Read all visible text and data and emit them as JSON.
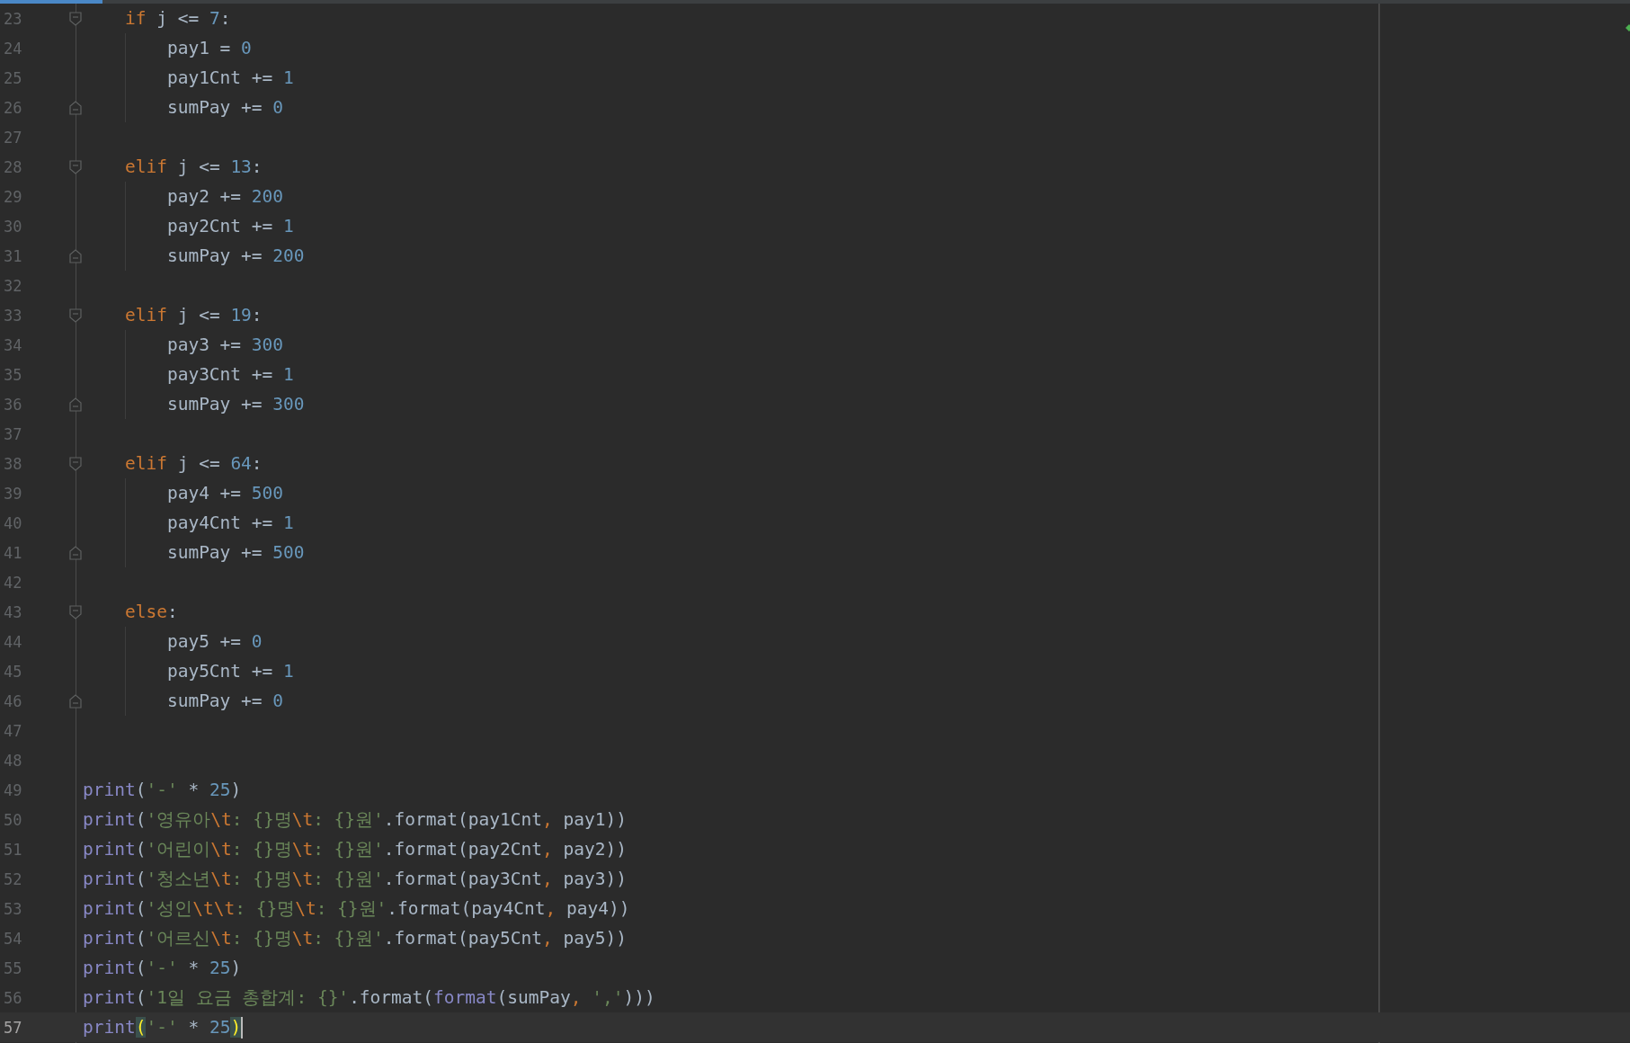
{
  "loop_body": [
    {
      "number": "23",
      "kind": "fold_start",
      "current": false,
      "tokens": [
        {
          "kind": "keyword",
          "text": "if"
        },
        {
          "kind": "plain",
          "text": " j <= "
        },
        {
          "kind": "number",
          "text": "7"
        },
        {
          "kind": "plain",
          "text": ":"
        }
      ],
      "children": [
        {
          "number": "24",
          "kind": "plain",
          "current": false,
          "tokens": [
            {
              "kind": "plain",
              "text": "pay1 = "
            },
            {
              "kind": "number",
              "text": "0"
            }
          ]
        },
        {
          "number": "25",
          "kind": "plain",
          "current": false,
          "tokens": [
            {
              "kind": "plain",
              "text": "pay1Cnt += "
            },
            {
              "kind": "number",
              "text": "1"
            }
          ]
        },
        {
          "number": "26",
          "kind": "fold_end",
          "current": false,
          "tokens": [
            {
              "kind": "plain",
              "text": "sumPay += "
            },
            {
              "kind": "number",
              "text": "0"
            }
          ]
        }
      ]
    },
    {
      "number": "27",
      "kind": "plain",
      "current": false
    },
    {
      "number": "28",
      "kind": "fold_start",
      "current": false,
      "tokens": [
        {
          "kind": "keyword",
          "text": "elif"
        },
        {
          "kind": "plain",
          "text": " j <= "
        },
        {
          "kind": "number",
          "text": "13"
        },
        {
          "kind": "plain",
          "text": ":"
        }
      ],
      "children": [
        {
          "number": "29",
          "kind": "plain",
          "current": false,
          "tokens": [
            {
              "kind": "plain",
              "text": "pay2 += "
            },
            {
              "kind": "number",
              "text": "200"
            }
          ]
        },
        {
          "number": "30",
          "kind": "plain",
          "current": false,
          "tokens": [
            {
              "kind": "plain",
              "text": "pay2Cnt += "
            },
            {
              "kind": "number",
              "text": "1"
            }
          ]
        },
        {
          "number": "31",
          "kind": "fold_end",
          "current": false,
          "tokens": [
            {
              "kind": "plain",
              "text": "sumPay += "
            },
            {
              "kind": "number",
              "text": "200"
            }
          ]
        }
      ]
    },
    {
      "number": "32",
      "kind": "plain",
      "current": false
    },
    {
      "number": "33",
      "kind": "fold_start",
      "current": false,
      "tokens": [
        {
          "kind": "keyword",
          "text": "elif"
        },
        {
          "kind": "plain",
          "text": " j <= "
        },
        {
          "kind": "number",
          "text": "19"
        },
        {
          "kind": "plain",
          "text": ":"
        }
      ],
      "children": [
        {
          "number": "34",
          "kind": "plain",
          "current": false,
          "tokens": [
            {
              "kind": "plain",
              "text": "pay3 += "
            },
            {
              "kind": "number",
              "text": "300"
            }
          ]
        },
        {
          "number": "35",
          "kind": "plain",
          "current": false,
          "tokens": [
            {
              "kind": "plain",
              "text": "pay3Cnt += "
            },
            {
              "kind": "number",
              "text": "1"
            }
          ]
        },
        {
          "number": "36",
          "kind": "fold_end",
          "current": false,
          "tokens": [
            {
              "kind": "plain",
              "text": "sumPay += "
            },
            {
              "kind": "number",
              "text": "300"
            }
          ]
        }
      ]
    },
    {
      "number": "37",
      "kind": "plain",
      "current": false
    },
    {
      "number": "38",
      "kind": "fold_start",
      "current": false,
      "tokens": [
        {
          "kind": "keyword",
          "text": "elif"
        },
        {
          "kind": "plain",
          "text": " j <= "
        },
        {
          "kind": "number",
          "text": "64"
        },
        {
          "kind": "plain",
          "text": ":"
        }
      ],
      "children": [
        {
          "number": "39",
          "kind": "plain",
          "current": false,
          "tokens": [
            {
              "kind": "plain",
              "text": "pay4 += "
            },
            {
              "kind": "number",
              "text": "500"
            }
          ]
        },
        {
          "number": "40",
          "kind": "plain",
          "current": false,
          "tokens": [
            {
              "kind": "plain",
              "text": "pay4Cnt += "
            },
            {
              "kind": "number",
              "text": "1"
            }
          ]
        },
        {
          "number": "41",
          "kind": "fold_end",
          "current": false,
          "tokens": [
            {
              "kind": "plain",
              "text": "sumPay += "
            },
            {
              "kind": "number",
              "text": "500"
            }
          ]
        }
      ]
    },
    {
      "number": "42",
      "kind": "plain",
      "current": false
    },
    {
      "number": "43",
      "kind": "fold_start",
      "current": false,
      "tokens": [
        {
          "kind": "keyword",
          "text": "else"
        },
        {
          "kind": "plain",
          "text": ":"
        }
      ],
      "children": [
        {
          "number": "44",
          "kind": "plain",
          "current": false,
          "tokens": [
            {
              "kind": "plain",
              "text": "pay5 += "
            },
            {
              "kind": "number",
              "text": "0"
            }
          ]
        },
        {
          "number": "45",
          "kind": "plain",
          "current": false,
          "tokens": [
            {
              "kind": "plain",
              "text": "pay5Cnt += "
            },
            {
              "kind": "number",
              "text": "1"
            }
          ]
        },
        {
          "number": "46",
          "kind": "fold_end",
          "current": false,
          "tokens": [
            {
              "kind": "plain",
              "text": "sumPay += "
            },
            {
              "kind": "number",
              "text": "0"
            }
          ]
        }
      ]
    },
    {
      "number": "47",
      "kind": "plain",
      "current": false
    },
    {
      "number": "48",
      "kind": "plain",
      "current": false
    }
  ],
  "statements": [
    {
      "number": "49",
      "kind": "plain",
      "current": false,
      "tokens": [
        {
          "kind": "builtin",
          "text": "print"
        },
        {
          "kind": "plain",
          "text": "("
        },
        {
          "kind": "string",
          "text": "'-'"
        },
        {
          "kind": "plain",
          "text": " * "
        },
        {
          "kind": "number",
          "text": "25"
        },
        {
          "kind": "plain",
          "text": ")"
        }
      ]
    },
    {
      "number": "50",
      "kind": "plain",
      "current": false,
      "tokens": [
        {
          "kind": "builtin",
          "text": "print"
        },
        {
          "kind": "plain",
          "text": "("
        },
        {
          "kind": "string",
          "text": "'영유아"
        },
        {
          "kind": "escape",
          "text": "\\t"
        },
        {
          "kind": "string",
          "text": ": {}명"
        },
        {
          "kind": "escape",
          "text": "\\t"
        },
        {
          "kind": "string",
          "text": ": {}원'"
        },
        {
          "kind": "plain",
          "text": ".format(pay1Cnt"
        },
        {
          "kind": "comma",
          "text": ","
        },
        {
          "kind": "plain",
          "text": " pay1))"
        }
      ]
    },
    {
      "number": "51",
      "kind": "plain",
      "current": false,
      "tokens": [
        {
          "kind": "builtin",
          "text": "print"
        },
        {
          "kind": "plain",
          "text": "("
        },
        {
          "kind": "string",
          "text": "'어린이"
        },
        {
          "kind": "escape",
          "text": "\\t"
        },
        {
          "kind": "string",
          "text": ": {}명"
        },
        {
          "kind": "escape",
          "text": "\\t"
        },
        {
          "kind": "string",
          "text": ": {}원'"
        },
        {
          "kind": "plain",
          "text": ".format(pay2Cnt"
        },
        {
          "kind": "comma",
          "text": ","
        },
        {
          "kind": "plain",
          "text": " pay2))"
        }
      ]
    },
    {
      "number": "52",
      "kind": "plain",
      "current": false,
      "tokens": [
        {
          "kind": "builtin",
          "text": "print"
        },
        {
          "kind": "plain",
          "text": "("
        },
        {
          "kind": "string",
          "text": "'청소년"
        },
        {
          "kind": "escape",
          "text": "\\t"
        },
        {
          "kind": "string",
          "text": ": {}명"
        },
        {
          "kind": "escape",
          "text": "\\t"
        },
        {
          "kind": "string",
          "text": ": {}원'"
        },
        {
          "kind": "plain",
          "text": ".format(pay3Cnt"
        },
        {
          "kind": "comma",
          "text": ","
        },
        {
          "kind": "plain",
          "text": " pay3))"
        }
      ]
    },
    {
      "number": "53",
      "kind": "plain",
      "current": false,
      "tokens": [
        {
          "kind": "builtin",
          "text": "print"
        },
        {
          "kind": "plain",
          "text": "("
        },
        {
          "kind": "string",
          "text": "'성인"
        },
        {
          "kind": "escape",
          "text": "\\t\\t"
        },
        {
          "kind": "string",
          "text": ": {}명"
        },
        {
          "kind": "escape",
          "text": "\\t"
        },
        {
          "kind": "string",
          "text": ": {}원'"
        },
        {
          "kind": "plain",
          "text": ".format(pay4Cnt"
        },
        {
          "kind": "comma",
          "text": ","
        },
        {
          "kind": "plain",
          "text": " pay4))"
        }
      ]
    },
    {
      "number": "54",
      "kind": "plain",
      "current": false,
      "tokens": [
        {
          "kind": "builtin",
          "text": "print"
        },
        {
          "kind": "plain",
          "text": "("
        },
        {
          "kind": "string",
          "text": "'어르신"
        },
        {
          "kind": "escape",
          "text": "\\t"
        },
        {
          "kind": "string",
          "text": ": {}명"
        },
        {
          "kind": "escape",
          "text": "\\t"
        },
        {
          "kind": "string",
          "text": ": {}원'"
        },
        {
          "kind": "plain",
          "text": ".format(pay5Cnt"
        },
        {
          "kind": "comma",
          "text": ","
        },
        {
          "kind": "plain",
          "text": " pay5))"
        }
      ]
    },
    {
      "number": "55",
      "kind": "plain",
      "current": false,
      "tokens": [
        {
          "kind": "builtin",
          "text": "print"
        },
        {
          "kind": "plain",
          "text": "("
        },
        {
          "kind": "string",
          "text": "'-'"
        },
        {
          "kind": "plain",
          "text": " * "
        },
        {
          "kind": "number",
          "text": "25"
        },
        {
          "kind": "plain",
          "text": ")"
        }
      ]
    },
    {
      "number": "56",
      "kind": "plain",
      "current": false,
      "tokens": [
        {
          "kind": "builtin",
          "text": "print"
        },
        {
          "kind": "plain",
          "text": "("
        },
        {
          "kind": "string",
          "text": "'1일 요금 총합계: {}'"
        },
        {
          "kind": "plain",
          "text": ".format("
        },
        {
          "kind": "builtin",
          "text": "format"
        },
        {
          "kind": "plain",
          "text": "(sumPay"
        },
        {
          "kind": "comma",
          "text": ", "
        },
        {
          "kind": "string",
          "text": "','"
        },
        {
          "kind": "plain",
          "text": ")))"
        }
      ]
    },
    {
      "number": "57",
      "kind": "plain",
      "current": true,
      "tokens": [
        {
          "kind": "builtin",
          "text": "print"
        },
        {
          "kind": "match",
          "text": "("
        },
        {
          "kind": "string",
          "text": "'-'"
        },
        {
          "kind": "plain",
          "text": " * "
        },
        {
          "kind": "number",
          "text": "25"
        },
        {
          "kind": "match",
          "text": ")"
        }
      ]
    }
  ]
}
